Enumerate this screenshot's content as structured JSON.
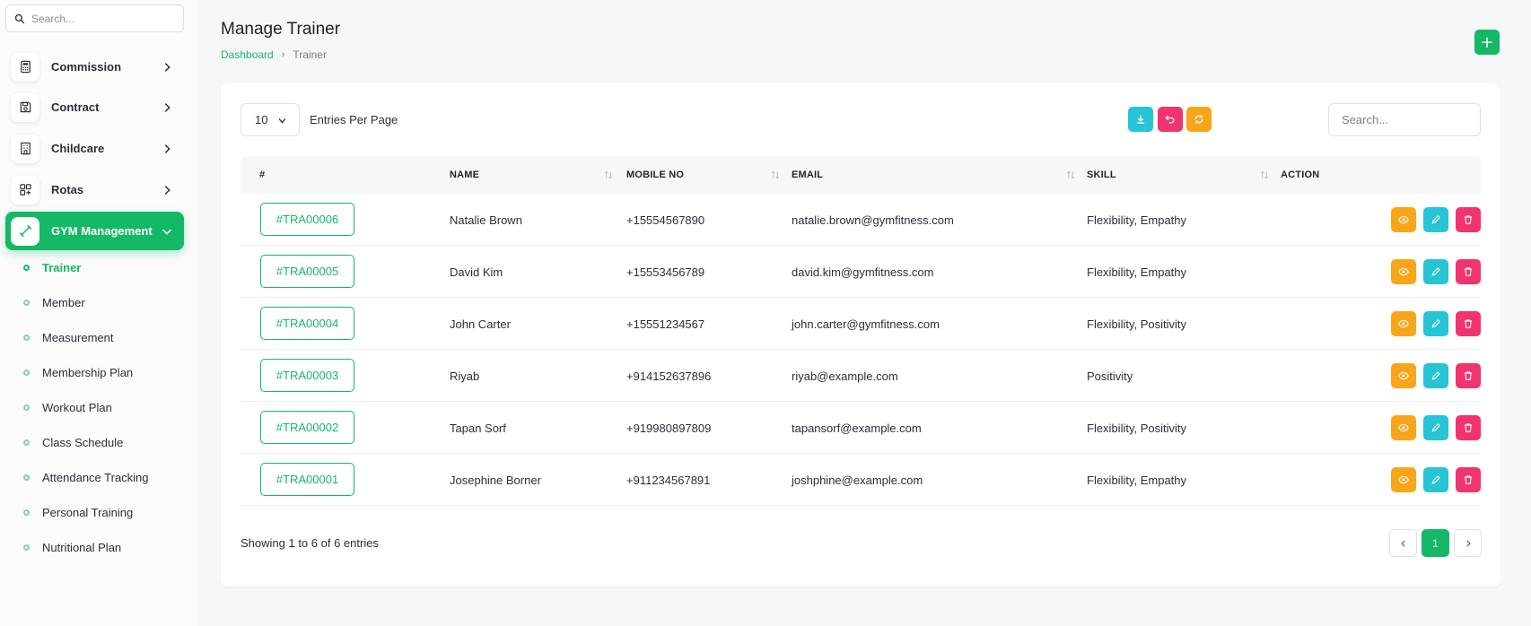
{
  "sidebar": {
    "search_placeholder": "Search...",
    "items": [
      {
        "label": "Commission",
        "icon": "calculator-icon"
      },
      {
        "label": "Contract",
        "icon": "save-icon"
      },
      {
        "label": "Childcare",
        "icon": "building-icon"
      },
      {
        "label": "Rotas",
        "icon": "apps-icon"
      },
      {
        "label": "GYM Management",
        "icon": "dumbbell-icon",
        "active": true
      }
    ],
    "subitems": [
      {
        "label": "Trainer",
        "active": true
      },
      {
        "label": "Member"
      },
      {
        "label": "Measurement"
      },
      {
        "label": "Membership Plan"
      },
      {
        "label": "Workout Plan"
      },
      {
        "label": "Class Schedule"
      },
      {
        "label": "Attendance Tracking"
      },
      {
        "label": "Personal Training"
      },
      {
        "label": "Nutritional Plan"
      }
    ]
  },
  "header": {
    "title": "Manage Trainer",
    "breadcrumb_link": "Dashboard",
    "breadcrumb_current": "Trainer",
    "add_label": "+"
  },
  "toolbar": {
    "entries_value": "10",
    "entries_label": "Entries Per Page",
    "search_placeholder": "Search..."
  },
  "table": {
    "columns": [
      "#",
      "NAME",
      "MOBILE NO",
      "EMAIL",
      "SKILL",
      "ACTION"
    ],
    "rows": [
      {
        "id": "#TRA00006",
        "name": "Natalie Brown",
        "mobile": "+15554567890",
        "email": "natalie.brown@gymfitness.com",
        "skill": "Flexibility, Empathy"
      },
      {
        "id": "#TRA00005",
        "name": "David Kim",
        "mobile": "+15553456789",
        "email": "david.kim@gymfitness.com",
        "skill": "Flexibility, Empathy"
      },
      {
        "id": "#TRA00004",
        "name": "John Carter",
        "mobile": "+15551234567",
        "email": "john.carter@gymfitness.com",
        "skill": "Flexibility, Positivity"
      },
      {
        "id": "#TRA00003",
        "name": "Riyab",
        "mobile": "+914152637896",
        "email": "riyab@example.com",
        "skill": "Positivity"
      },
      {
        "id": "#TRA00002",
        "name": "Tapan Sorf",
        "mobile": "+919980897809",
        "email": "tapansorf@example.com",
        "skill": "Flexibility, Positivity"
      },
      {
        "id": "#TRA00001",
        "name": "Josephine Borner",
        "mobile": "+911234567891",
        "email": "joshphine@example.com",
        "skill": "Flexibility, Empathy"
      }
    ]
  },
  "footer": {
    "showing": "Showing 1 to 6 of 6 entries",
    "current_page": "1"
  },
  "colors": {
    "primary": "#14b866",
    "info": "#27c4d6",
    "danger": "#f0356e",
    "warning": "#f9a51a"
  }
}
